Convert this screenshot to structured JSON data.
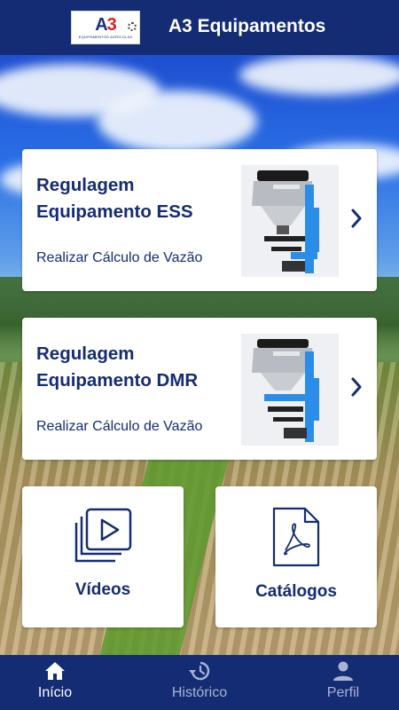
{
  "header": {
    "title": "A3 Equipamentos",
    "logo_text": "A3",
    "logo_subtitle": "EQUIPAMENTOS AGRÍCOLAS"
  },
  "cards": [
    {
      "title_line1": "Regulagem",
      "title_line2": "Equipamento ESS",
      "subtitle": "Realizar Cálculo de Vazão",
      "icon": "chevron-right-icon"
    },
    {
      "title_line1": "Regulagem",
      "title_line2": "Equipamento DMR",
      "subtitle": "Realizar Cálculo de Vazão",
      "icon": "chevron-right-icon"
    }
  ],
  "tiles": [
    {
      "label": "Vídeos",
      "icon": "video-library-icon"
    },
    {
      "label": "Catálogos",
      "icon": "pdf-document-icon"
    }
  ],
  "nav": {
    "items": [
      {
        "label": "Início",
        "icon": "home-icon",
        "active": true
      },
      {
        "label": "Histórico",
        "icon": "history-icon",
        "active": false
      },
      {
        "label": "Perfil",
        "icon": "person-icon",
        "active": false
      }
    ]
  },
  "colors": {
    "primary": "#142c73",
    "accent_blue": "#2a8ee8",
    "logo_red": "#d61f26",
    "card_bg": "#ffffff",
    "nav_inactive": "#aab3d4"
  }
}
